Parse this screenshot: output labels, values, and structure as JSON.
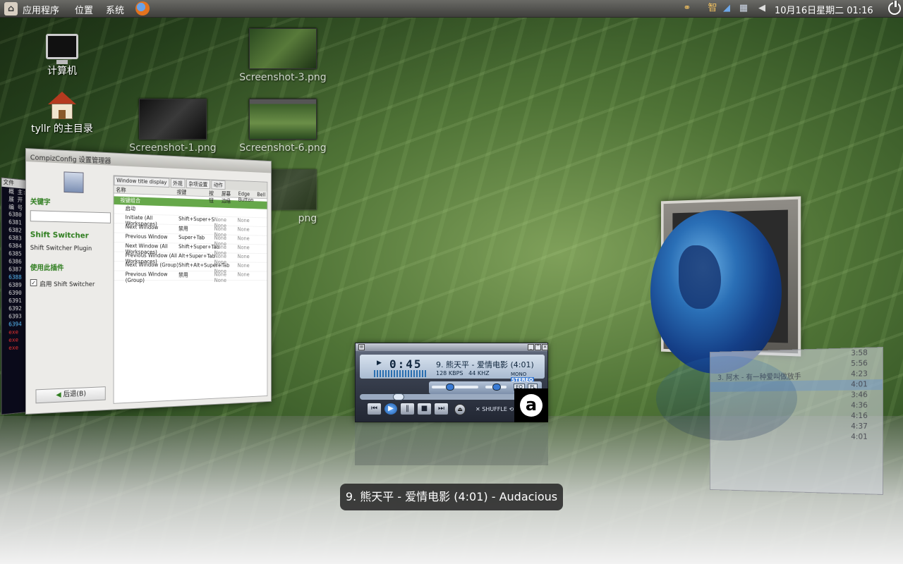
{
  "panel": {
    "menus": [
      "应用程序",
      "位置",
      "系统"
    ],
    "clock": "10月16日星期二 01:16",
    "tray_icons": [
      "network-icon",
      "input-method-icon",
      "update-icon",
      "network-manager-icon",
      "volume-icon"
    ]
  },
  "desktop": {
    "icons": [
      {
        "label": "计算机",
        "icon": "computer-icon"
      },
      {
        "label": "tyllr 的主目录",
        "icon": "home-folder-icon"
      },
      {
        "label": "Screenshot-1.png",
        "icon": "image-thumbnail"
      },
      {
        "label": "Screenshot-3.png",
        "icon": "image-thumbnail"
      },
      {
        "label": "Screenshot-6.png",
        "icon": "image-thumbnail"
      },
      {
        "label": "png",
        "icon": "image-thumbnail"
      }
    ]
  },
  "ccsm": {
    "title": "CompizConfig 设置管理器",
    "keyword_label": "关键字",
    "plugin_name": "Shift Switcher",
    "plugin_desc": "Shift Switcher Plugin",
    "use_plugin_label": "使用此插件",
    "enable_label": "启用 Shift Switcher",
    "back_label": "后退(B)",
    "tabs": [
      "Window title display",
      "外观",
      "杂项设置",
      "动作"
    ],
    "columns": [
      "名称",
      "按键",
      "按钮",
      "屏幕边缘",
      "Edge Button",
      "Bell"
    ],
    "group": "按键组合",
    "rows": [
      {
        "name": "启动",
        "key": "",
        "opt": "",
        "val": ""
      },
      {
        "name": "Initiate (All Workspaces)",
        "key": "Shift+Super+S",
        "opt": "None None",
        "val": "None"
      },
      {
        "name": "Next Window",
        "key": "禁用",
        "opt": "None None",
        "val": "None"
      },
      {
        "name": "Previous Window",
        "key": "Super+Tab",
        "opt": "None None",
        "val": "None"
      },
      {
        "name": "Next Window (All Workspaces)",
        "key": "Shift+Super+Tab",
        "opt": "None None",
        "val": "None"
      },
      {
        "name": "Previous Window (All Workspaces)",
        "key": "Alt+Super+Tab",
        "opt": "None None",
        "val": "None"
      },
      {
        "name": "Next Window (Group)",
        "key": "Shift+Alt+Super+Tab",
        "opt": "None None",
        "val": "None"
      },
      {
        "name": "Previous Window (Group)",
        "key": "禁用",
        "opt": "None None",
        "val": "None"
      }
    ]
  },
  "terminal": {
    "title": "文件",
    "lines": [
      "概 主:",
      "展 开",
      "编 号",
      "6380",
      "6381",
      "6382",
      "6383",
      "6384",
      "6385",
      "6386",
      "6387",
      "6388",
      "6389",
      "6390",
      "6391",
      "6392",
      "6393",
      "6394"
    ]
  },
  "player": {
    "time": "0:45",
    "song": "9. 熊天平 - 爱情电影 (4:01)",
    "bitrate": "128",
    "bitrate_unit": "KBPS",
    "samplerate": "44",
    "samplerate_unit": "KHZ",
    "mono": "MONO",
    "stereo": "STEREO",
    "shuffle": "SHUFFLE",
    "position_fraction": 0.19
  },
  "playlist": {
    "items": [
      {
        "num": "",
        "title": "",
        "dur": "3:58"
      },
      {
        "num": "",
        "title": "",
        "dur": "5:56"
      },
      {
        "num": "3.",
        "title": "阿木 - 有一种爱叫做放手",
        "dur": "4:23"
      },
      {
        "num": "",
        "title": "",
        "dur": "4:01"
      },
      {
        "num": "",
        "title": "",
        "dur": "3:46"
      },
      {
        "num": "",
        "title": "",
        "dur": "4:36"
      },
      {
        "num": "",
        "title": "",
        "dur": "4:16"
      },
      {
        "num": "",
        "title": "",
        "dur": "4:37"
      },
      {
        "num": "",
        "title": "",
        "dur": "4:01"
      }
    ]
  },
  "switcher": {
    "caption": "9. 熊天平 - 爱情电影 (4:01) - Audacious"
  }
}
